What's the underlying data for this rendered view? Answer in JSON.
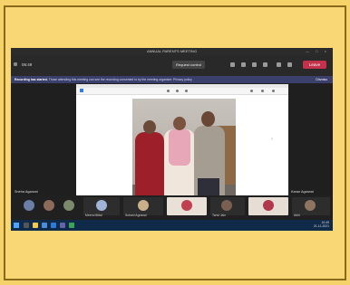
{
  "window": {
    "title": "ANNUAL PARENTS MEETING",
    "controls": "— □ ×"
  },
  "toolbar": {
    "meeting_time": "06:49",
    "request_button": "Request control",
    "leave_button": "Leave",
    "accent": "#c4314b"
  },
  "notice": {
    "title": "Recording has started.",
    "text": "Those attending this meeting can see the recording consented to by the meeting organiser. Privacy policy",
    "dismiss": "Dismiss"
  },
  "participants": {
    "self_label": "Sneha Agarwal",
    "right_label": "Karan Agarwal",
    "gallery": [
      "Meera Mittal",
      "Suhani Agrawal",
      "Tanvi Jain",
      "Abhi"
    ]
  },
  "taskbar": {
    "time": "10:49",
    "date": "21-11-2021"
  }
}
